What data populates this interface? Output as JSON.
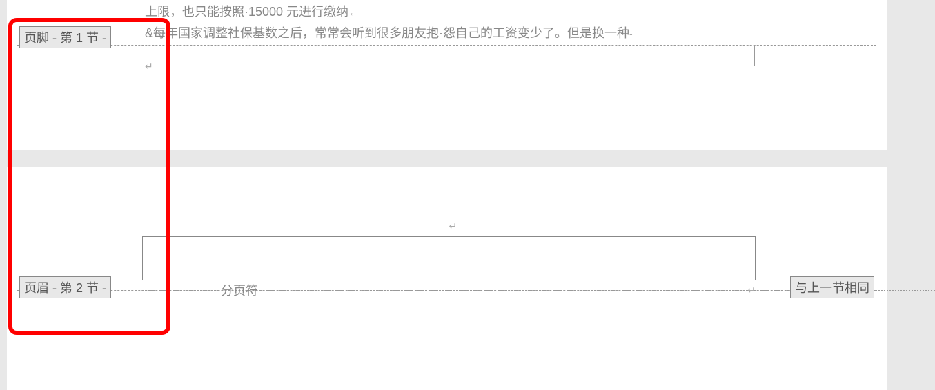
{
  "page1": {
    "body_line1": "上限，也只能按照·15000 元进行缴纳",
    "body_line2": "&每年国家调整社保基数之后，常常会听到很多朋友抱·怨自己的工资变少了。但是换一种",
    "footer_label": "页脚 - 第 1 节 -"
  },
  "page2": {
    "header_label": "页眉 - 第 2 节 -",
    "same_as_prev": "与上一节相同",
    "page_break": "分页符"
  },
  "marks": {
    "return": "↵",
    "line_end": "←"
  }
}
